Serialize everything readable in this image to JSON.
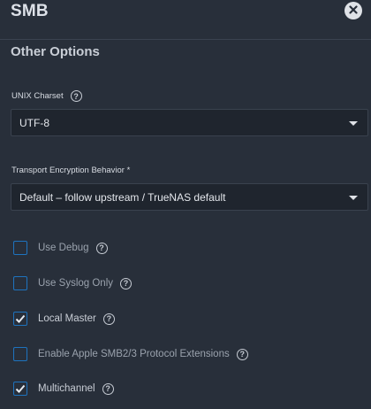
{
  "header": {
    "title": "SMB"
  },
  "section": {
    "title": "Other Options"
  },
  "unix_charset": {
    "label": "UNIX Charset",
    "value": "UTF-8"
  },
  "transport": {
    "label": "Transport Encryption Behavior *",
    "value": "Default – follow upstream / TrueNAS default"
  },
  "options": [
    {
      "label": "Use Debug",
      "checked": false
    },
    {
      "label": "Use Syslog Only",
      "checked": false
    },
    {
      "label": "Local Master",
      "checked": true
    },
    {
      "label": "Enable Apple SMB2/3 Protocol Extensions",
      "checked": false
    },
    {
      "label": "Multichannel",
      "checked": true
    }
  ],
  "colors": {
    "background": "#282f3a",
    "accent": "#1e73be",
    "input_bg": "#1f252e"
  },
  "icons": {
    "close": "close-circle-icon",
    "help": "help-circle-icon",
    "caret": "chevron-down-icon",
    "check": "check-icon"
  }
}
